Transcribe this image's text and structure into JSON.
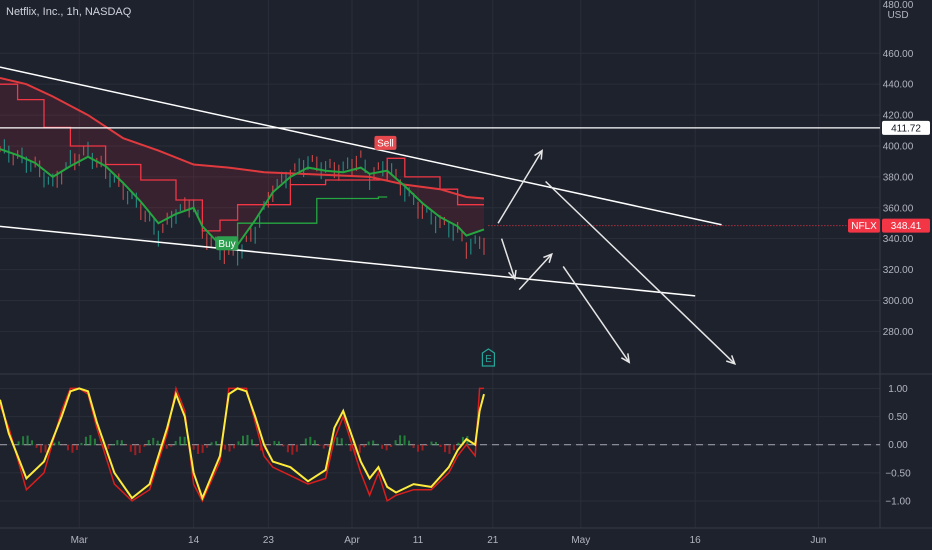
{
  "title": "Netflix, Inc., 1h, NASDAQ",
  "currency": "USD",
  "colors": {
    "background": "#1e222d",
    "price_ma": "#26a641",
    "slow_ma": "#e03a3e",
    "stop_line": "#f23645",
    "trendline": "#ffffff",
    "osc_fast": "#ffeb3b",
    "osc_slow": "#d91e1e",
    "buy": "#2e9e4f",
    "sell": "#e5484d",
    "price_tag": "#f23645"
  },
  "chart_data": [
    {
      "type": "line",
      "title": "Netflix, Inc., 1h, NASDAQ",
      "y_axis_unit": "USD",
      "ylim": [
        255,
        488
      ],
      "y_ticks": [
        "460.00",
        "440.00",
        "420.00",
        "400.00",
        "380.00",
        "360.00",
        "340.00",
        "320.00",
        "300.00",
        "280.00"
      ],
      "top_tick_partial": "480.00",
      "x_ticks": [
        "Mar",
        "14",
        "23",
        "Apr",
        "11",
        "21",
        "May",
        "16",
        "Jun"
      ],
      "x_tick_positions": [
        0.09,
        0.22,
        0.305,
        0.4,
        0.475,
        0.56,
        0.66,
        0.79,
        0.93
      ],
      "series": [
        {
          "key": "price",
          "x": [
            0,
            0.02,
            0.04,
            0.06,
            0.08,
            0.1,
            0.12,
            0.14,
            0.16,
            0.18,
            0.2,
            0.22,
            0.23,
            0.25,
            0.27,
            0.29,
            0.31,
            0.33,
            0.35,
            0.37,
            0.39,
            0.41,
            0.42,
            0.44,
            0.46,
            0.48,
            0.5,
            0.52,
            0.53,
            0.55
          ],
          "values": [
            398,
            393,
            387,
            375,
            390,
            396,
            384,
            372,
            360,
            343,
            357,
            363,
            344,
            332,
            330,
            345,
            372,
            382,
            390,
            386,
            385,
            392,
            380,
            388,
            371,
            358,
            350,
            345,
            335,
            338
          ]
        },
        {
          "key": "ema",
          "x": [
            0,
            0.02,
            0.04,
            0.06,
            0.08,
            0.1,
            0.12,
            0.14,
            0.16,
            0.18,
            0.2,
            0.22,
            0.23,
            0.25,
            0.27,
            0.29,
            0.31,
            0.33,
            0.35,
            0.37,
            0.39,
            0.41,
            0.42,
            0.44,
            0.46,
            0.48,
            0.5,
            0.52,
            0.53,
            0.55
          ],
          "values": [
            398,
            394,
            389,
            380,
            387,
            393,
            387,
            376,
            364,
            350,
            356,
            360,
            348,
            336,
            336,
            352,
            370,
            380,
            386,
            384,
            383,
            386,
            382,
            384,
            374,
            363,
            354,
            348,
            342,
            346
          ]
        },
        {
          "key": "sma",
          "x": [
            0,
            0.03,
            0.06,
            0.1,
            0.14,
            0.18,
            0.22,
            0.26,
            0.3,
            0.34,
            0.38,
            0.42,
            0.46,
            0.5,
            0.53,
            0.55
          ],
          "values": [
            444,
            440,
            432,
            420,
            405,
            397,
            388,
            386,
            383,
            382,
            381,
            380,
            375,
            372,
            367,
            366
          ]
        },
        {
          "key": "stop",
          "x": [
            0,
            0.02,
            0.02,
            0.05,
            0.05,
            0.08,
            0.08,
            0.12,
            0.12,
            0.16,
            0.16,
            0.2,
            0.2,
            0.23,
            0.23,
            0.25,
            0.25,
            0.27,
            0.27,
            0.33,
            0.33,
            0.37,
            0.37,
            0.44,
            0.44,
            0.46,
            0.46,
            0.5,
            0.5,
            0.52,
            0.52,
            0.55
          ],
          "values": [
            440,
            440,
            430,
            430,
            412,
            412,
            400,
            400,
            388,
            388,
            378,
            378,
            365,
            365,
            345,
            345,
            352,
            352,
            362,
            362,
            375,
            375,
            378,
            378,
            392,
            392,
            380,
            380,
            372,
            372,
            362,
            362
          ]
        },
        {
          "key": "support",
          "x": [
            0.25,
            0.27,
            0.27,
            0.36,
            0.36,
            0.43,
            0.43,
            0.44
          ],
          "values": [
            333,
            333,
            350,
            350,
            366,
            366,
            367,
            367
          ]
        }
      ],
      "trendlines": [
        {
          "from": [
            0,
            451
          ],
          "to": [
            0.82,
            349
          ]
        },
        {
          "from": [
            0,
            348
          ],
          "to": [
            0.79,
            303
          ]
        }
      ],
      "hline": 411.72,
      "hline_label": "411.72",
      "price_tag": {
        "symbol": "NFLX",
        "value": "348.41",
        "level": 348.41,
        "x_start": 0.555
      },
      "annotations": [
        {
          "text": "Sell",
          "x": 0.438,
          "y": 402
        },
        {
          "text": "Buy",
          "x": 0.258,
          "y": 337
        }
      ],
      "arrows": [
        {
          "from": [
            0.566,
            350
          ],
          "to": [
            0.616,
            397
          ]
        },
        {
          "from": [
            0.57,
            340
          ],
          "to": [
            0.585,
            314
          ]
        },
        {
          "from": [
            0.59,
            307
          ],
          "to": [
            0.627,
            330
          ]
        },
        {
          "from": [
            0.62,
            377
          ],
          "to": [
            0.835,
            259
          ]
        },
        {
          "from": [
            0.64,
            322
          ],
          "to": [
            0.715,
            260
          ]
        }
      ]
    },
    {
      "type": "line",
      "title": "",
      "ylim": [
        -1.25,
        1.15
      ],
      "y_ticks": [
        "1.00",
        "0.50",
        "0.00",
        "−0.50",
        "−1.00"
      ],
      "y_tick_values": [
        1,
        0.5,
        0,
        -0.5,
        -1
      ],
      "zero_line": 0,
      "event_marker": {
        "text": "E",
        "x": 0.555
      },
      "series": [
        {
          "key": "fast",
          "x": [
            0,
            0.01,
            0.03,
            0.05,
            0.07,
            0.08,
            0.09,
            0.1,
            0.11,
            0.13,
            0.15,
            0.17,
            0.19,
            0.2,
            0.21,
            0.22,
            0.23,
            0.25,
            0.26,
            0.27,
            0.28,
            0.29,
            0.3,
            0.31,
            0.33,
            0.35,
            0.37,
            0.38,
            0.39,
            0.41,
            0.42,
            0.43,
            0.44,
            0.45,
            0.47,
            0.49,
            0.51,
            0.52,
            0.53,
            0.54,
            0.545,
            0.55
          ],
          "values": [
            0.8,
            0.2,
            -0.6,
            -0.3,
            0.5,
            0.95,
            1.0,
            0.95,
            0.4,
            -0.5,
            -0.95,
            -0.7,
            0.3,
            0.9,
            0.5,
            -0.5,
            -0.95,
            -0.2,
            0.9,
            1.0,
            0.95,
            0.5,
            0.0,
            -0.3,
            -0.4,
            -0.65,
            -0.45,
            0.3,
            0.6,
            -0.3,
            -0.6,
            -0.4,
            -0.75,
            -0.85,
            -0.7,
            -0.75,
            -0.4,
            -0.1,
            0.1,
            0.0,
            0.6,
            0.9
          ]
        },
        {
          "key": "slow",
          "x": [
            0,
            0.01,
            0.03,
            0.05,
            0.07,
            0.08,
            0.09,
            0.1,
            0.11,
            0.13,
            0.15,
            0.17,
            0.19,
            0.2,
            0.21,
            0.22,
            0.23,
            0.25,
            0.26,
            0.27,
            0.28,
            0.29,
            0.3,
            0.31,
            0.33,
            0.35,
            0.37,
            0.38,
            0.39,
            0.41,
            0.42,
            0.43,
            0.44,
            0.45,
            0.47,
            0.49,
            0.51,
            0.52,
            0.53,
            0.54,
            0.545,
            0.55
          ],
          "values": [
            0.7,
            0.3,
            -0.8,
            -0.5,
            0.6,
            1.0,
            1.0,
            0.9,
            0.3,
            -0.7,
            -1.0,
            -0.8,
            0.2,
            1.0,
            0.6,
            -0.7,
            -1.0,
            -0.3,
            1.0,
            1.0,
            1.0,
            0.4,
            -0.2,
            -0.4,
            -0.55,
            -0.7,
            -0.6,
            0.1,
            0.5,
            -0.5,
            -0.9,
            -0.5,
            -1.0,
            -0.9,
            -0.8,
            -0.8,
            -0.5,
            -0.2,
            0.0,
            -0.2,
            1.0,
            1.0
          ]
        }
      ]
    }
  ]
}
